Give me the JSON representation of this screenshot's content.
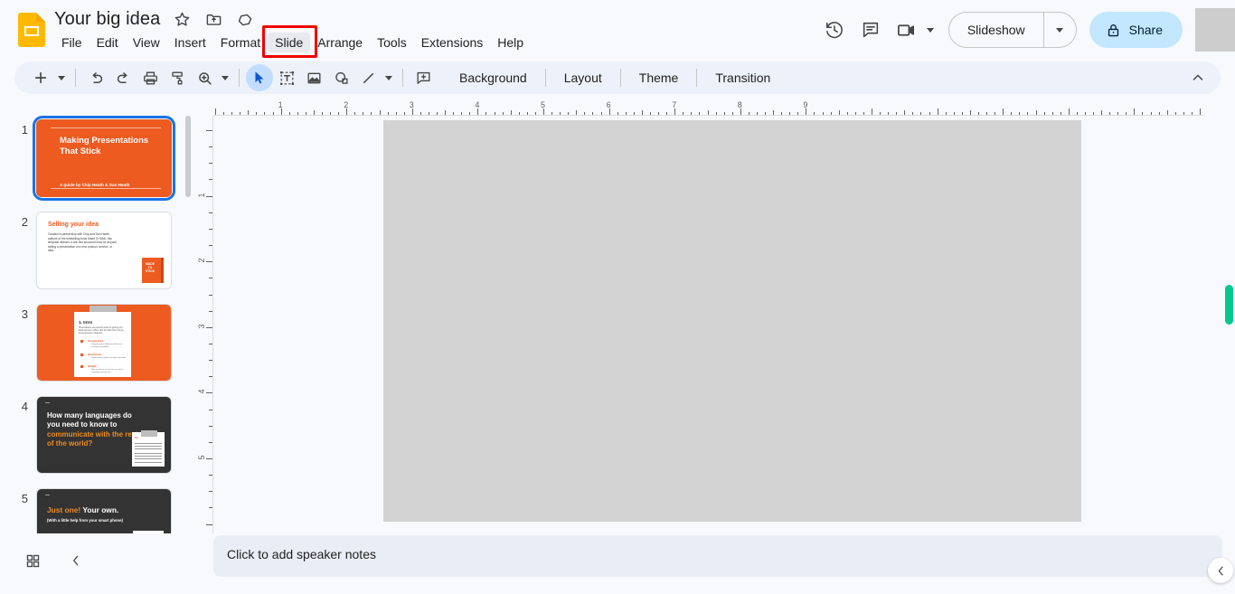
{
  "app": {
    "name": "Google Slides",
    "logo_icon": "slides-logo-icon"
  },
  "header": {
    "doc_title": "Your big idea",
    "icons": [
      {
        "name": "star-icon",
        "label": "Star"
      },
      {
        "name": "move-to-folder-icon",
        "label": "Move"
      },
      {
        "name": "cloud-saved-icon",
        "label": "Saved to Drive"
      }
    ],
    "menus": [
      {
        "label": "File",
        "active": false
      },
      {
        "label": "Edit",
        "active": false
      },
      {
        "label": "View",
        "active": false
      },
      {
        "label": "Insert",
        "active": false
      },
      {
        "label": "Format",
        "active": false
      },
      {
        "label": "Slide",
        "active": true
      },
      {
        "label": "Arrange",
        "active": false
      },
      {
        "label": "Tools",
        "active": false
      },
      {
        "label": "Extensions",
        "active": false
      },
      {
        "label": "Help",
        "active": false
      }
    ],
    "right": {
      "history_icon": "version-history-icon",
      "comment_icon": "comment-icon",
      "meet_icon": "meet-camera-icon",
      "slideshow_label": "Slideshow",
      "slideshow_caret_icon": "chevron-down-icon",
      "share_label": "Share",
      "share_lock_icon": "lock-icon",
      "avatar": "avatar"
    },
    "highlight_color": "#F00000"
  },
  "toolbar": {
    "icons": [
      {
        "name": "new-slide-icon",
        "label": "New slide"
      },
      {
        "name": "undo-icon",
        "label": "Undo"
      },
      {
        "name": "redo-icon",
        "label": "Redo"
      },
      {
        "name": "print-icon",
        "label": "Print"
      },
      {
        "name": "paint-format-icon",
        "label": "Paint format"
      },
      {
        "name": "zoom-icon",
        "label": "Zoom"
      },
      {
        "name": "select-icon",
        "label": "Select"
      },
      {
        "name": "text-box-icon",
        "label": "Text box"
      },
      {
        "name": "image-icon",
        "label": "Insert image"
      },
      {
        "name": "shape-icon",
        "label": "Shape"
      },
      {
        "name": "line-icon",
        "label": "Line"
      },
      {
        "name": "add-comment-icon",
        "label": "Add comment"
      }
    ],
    "background_label": "Background",
    "layout_label": "Layout",
    "theme_label": "Theme",
    "transition_label": "Transition",
    "collapse_icon": "chevron-up-icon",
    "selected_tool": "select-icon"
  },
  "filmstrip": {
    "slides": [
      {
        "number": "1",
        "selected": true,
        "title": "Making Presentations That Stick",
        "subtitle": "A guide by Chip Heath & Dan Heath",
        "bg": "#ED5B21"
      },
      {
        "number": "2",
        "selected": false,
        "title": "Selling your idea",
        "body": "Created in partnership with Chip and Dan Heath, authors of the bestselling book Made To Stick, this template delivers a one-two knockout blow for anyone selling a presentation of a new product, service, or idea.",
        "book_text": "MADE TO STICK",
        "bg": "#FFFFFF"
      },
      {
        "number": "3",
        "selected": false,
        "title": "1. Intro",
        "body": "Presentations are powerful tools for getting your ideas across to others. But too often they end up being ignored or forgotten.",
        "items": [
          {
            "head": "Unexpected",
            "text": "Surprising your audience makes your message memorable."
          },
          {
            "head": "Emotional",
            "text": "Stories make people care about your idea."
          },
          {
            "head": "Simple",
            "text": "Strip an idea to its core so it is easy to remember and pass on."
          }
        ],
        "bg": "#ED5B21"
      },
      {
        "number": "4",
        "selected": false,
        "title_plain": "How many languages do you need to know to ",
        "title_highlight": "communicate with the rest of the world?",
        "bg": "#333333"
      },
      {
        "number": "5",
        "selected": false,
        "title_highlight": "Just one!",
        "title_plain": " Your own.",
        "subtitle": "(With a little help from your smart phone)",
        "bg": "#333333"
      }
    ],
    "scrollbar": "filmstrip-scrollbar"
  },
  "rulers": {
    "horizontal_labels": [
      "1",
      "2",
      "3",
      "4",
      "5",
      "6",
      "7",
      "8",
      "9"
    ],
    "vertical_labels": [
      "1",
      "2",
      "3",
      "4",
      "5"
    ],
    "units": "inches"
  },
  "canvas": {
    "slide_background": "#D3D3D3",
    "name": "slide-editing-canvas"
  },
  "notes": {
    "placeholder": "Click to add speaker notes"
  },
  "bottom_left": {
    "grid_view_icon": "grid-view-icon",
    "collapse_filmstrip_icon": "chevron-left-icon"
  },
  "right_panel": {
    "scroll_indicator_color": "#00C98D",
    "collapse_icon": "chevron-left-icon"
  }
}
